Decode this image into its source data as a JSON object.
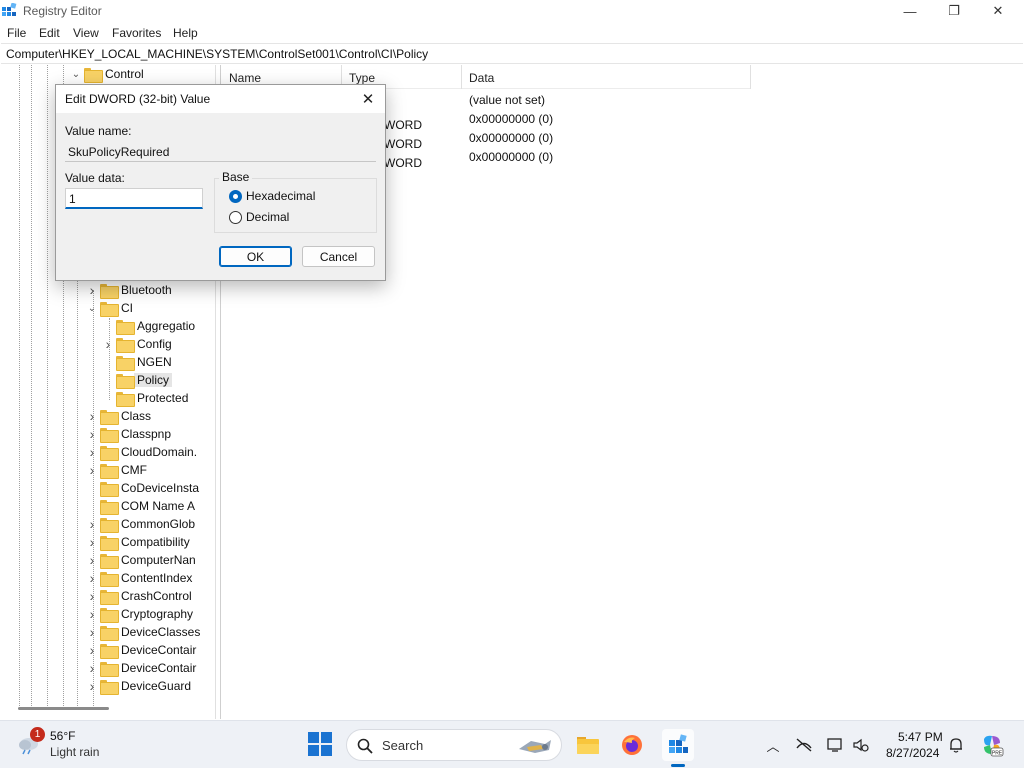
{
  "window": {
    "title": "Registry Editor",
    "controls": {
      "minimize": "—",
      "maximize": "❐",
      "close": "✕"
    }
  },
  "menu": [
    "File",
    "Edit",
    "View",
    "Favorites",
    "Help"
  ],
  "address": "Computer\\HKEY_LOCAL_MACHINE\\SYSTEM\\ControlSet001\\Control\\CI\\Policy",
  "tree": {
    "top_item": "Control",
    "items": [
      {
        "label": "Bluetooth",
        "expander": "collapsed"
      },
      {
        "label": "CI",
        "expander": "expanded"
      },
      {
        "label": "Aggregatio",
        "expander": "none"
      },
      {
        "label": "Config",
        "expander": "collapsed"
      },
      {
        "label": "NGEN",
        "expander": "none"
      },
      {
        "label": "Policy",
        "expander": "none",
        "selected": true
      },
      {
        "label": "Protected",
        "expander": "none"
      },
      {
        "label": "Class",
        "expander": "collapsed"
      },
      {
        "label": "Classpnp",
        "expander": "collapsed"
      },
      {
        "label": "CloudDomain.",
        "expander": "collapsed"
      },
      {
        "label": "CMF",
        "expander": "collapsed"
      },
      {
        "label": "CoDeviceInsta",
        "expander": "none"
      },
      {
        "label": "COM Name A",
        "expander": "none"
      },
      {
        "label": "CommonGlob",
        "expander": "collapsed"
      },
      {
        "label": "Compatibility",
        "expander": "collapsed"
      },
      {
        "label": "ComputerNan",
        "expander": "collapsed"
      },
      {
        "label": "ContentIndex",
        "expander": "collapsed"
      },
      {
        "label": "CrashControl",
        "expander": "collapsed"
      },
      {
        "label": "Cryptography",
        "expander": "collapsed"
      },
      {
        "label": "DeviceClasses",
        "expander": "collapsed"
      },
      {
        "label": "DeviceContair",
        "expander": "collapsed"
      },
      {
        "label": "DeviceContair",
        "expander": "collapsed"
      },
      {
        "label": "DeviceGuard",
        "expander": "collapsed"
      }
    ]
  },
  "list": {
    "columns": [
      "Name",
      "Type",
      "Data"
    ],
    "rows": [
      {
        "type": "",
        "data": "(value not set)"
      },
      {
        "type": "WORD",
        "data": "0x00000000 (0)"
      },
      {
        "type": "WORD",
        "data": "0x00000000 (0)"
      },
      {
        "type": "WORD",
        "data": "0x00000000 (0)"
      }
    ]
  },
  "dialog": {
    "title": "Edit DWORD (32-bit) Value",
    "close": "✕",
    "value_name_label": "Value name:",
    "value_name": "SkuPolicyRequired",
    "value_data_label": "Value data:",
    "value_data": "1",
    "base_label": "Base",
    "base_options": [
      {
        "label": "Hexadecimal",
        "checked": true
      },
      {
        "label": "Decimal",
        "checked": false
      }
    ],
    "ok": "OK",
    "cancel": "Cancel"
  },
  "taskbar": {
    "weather_badge": "1",
    "temperature": "56°F",
    "condition": "Light rain",
    "search_placeholder": "Search",
    "time": "5:47 PM",
    "date": "8/27/2024",
    "tray_chevron": "︿"
  },
  "colors": {
    "accent": "#0067c0",
    "folder": "#f8d266",
    "taskbar": "#eef1f6"
  }
}
